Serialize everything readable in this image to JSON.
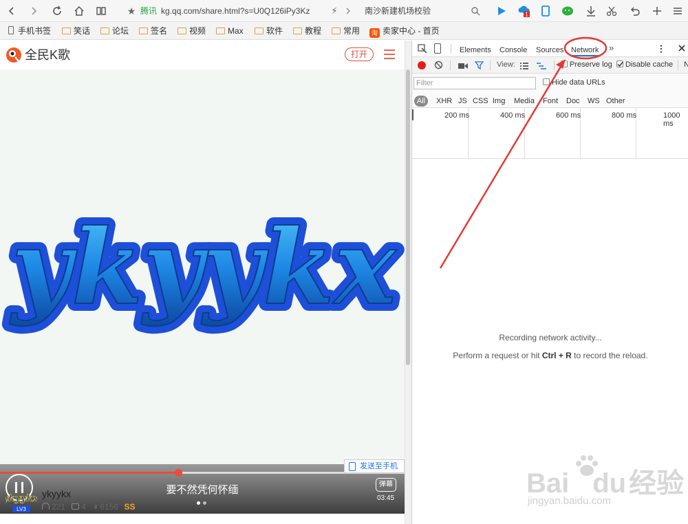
{
  "browser": {
    "address_source": "腾讯",
    "address_url": "kg.qq.com/share.html?s=U0Q126iPy3Kz",
    "search_text": "南沙新建机场校验",
    "badge_count": "1"
  },
  "bookmarks": [
    {
      "label": "手机书签",
      "icon": "phone-icon"
    },
    {
      "label": "笑话",
      "icon": "folder-icon"
    },
    {
      "label": "论坛",
      "icon": "folder-icon"
    },
    {
      "label": "签名",
      "icon": "folder-icon"
    },
    {
      "label": "视频",
      "icon": "folder-icon"
    },
    {
      "label": "Max",
      "icon": "folder-icon"
    },
    {
      "label": "软件",
      "icon": "folder-icon"
    },
    {
      "label": "教程",
      "icon": "folder-icon"
    },
    {
      "label": "常用",
      "icon": "folder-icon"
    },
    {
      "label": "卖家中心 - 首页",
      "icon": "taobao-icon"
    }
  ],
  "app": {
    "logo_text": "全民K歌",
    "open_button": "打开",
    "cover_text": "ykyykx",
    "lyric": "要不然凭何怀缅",
    "danmaku_label": "弹幕",
    "time": "03:45",
    "send_to_phone": "发送至手机",
    "progress": 0.44,
    "user": {
      "name": "ykyykx",
      "level": "LV3",
      "listens": "221",
      "comments": "4",
      "gifts": "6156",
      "rank": "SS"
    }
  },
  "devtools": {
    "tabs": [
      "Elements",
      "Console",
      "Sources",
      "Network"
    ],
    "active_tab": "Network",
    "view_label": "View:",
    "preserve_log": "Preserve log",
    "disable_cache": "Disable cache",
    "overflow_letter": "N",
    "filter_placeholder": "Filter",
    "hide_data_urls": "Hide data URLs",
    "filter_types": [
      "All",
      "XHR",
      "JS",
      "CSS",
      "Img",
      "Media",
      "Font",
      "Doc",
      "WS",
      "Other"
    ],
    "timeline_ticks": [
      "200 ms",
      "400 ms",
      "600 ms",
      "800 ms",
      "1000 ms"
    ],
    "empty_title": "Recording network activity...",
    "empty_hint_pre": "Perform a request or hit ",
    "empty_hint_keys": "Ctrl + R",
    "empty_hint_post": " to record the reload."
  },
  "watermark": {
    "brand": "Bai",
    "brand2": "du",
    "brand_cn": "经验",
    "url": "jingyan.baidu.com"
  },
  "colors": {
    "accent_red": "#e84c3d",
    "cover_blue": "#1e4fd8",
    "devtools_blue": "#1a73e8"
  }
}
